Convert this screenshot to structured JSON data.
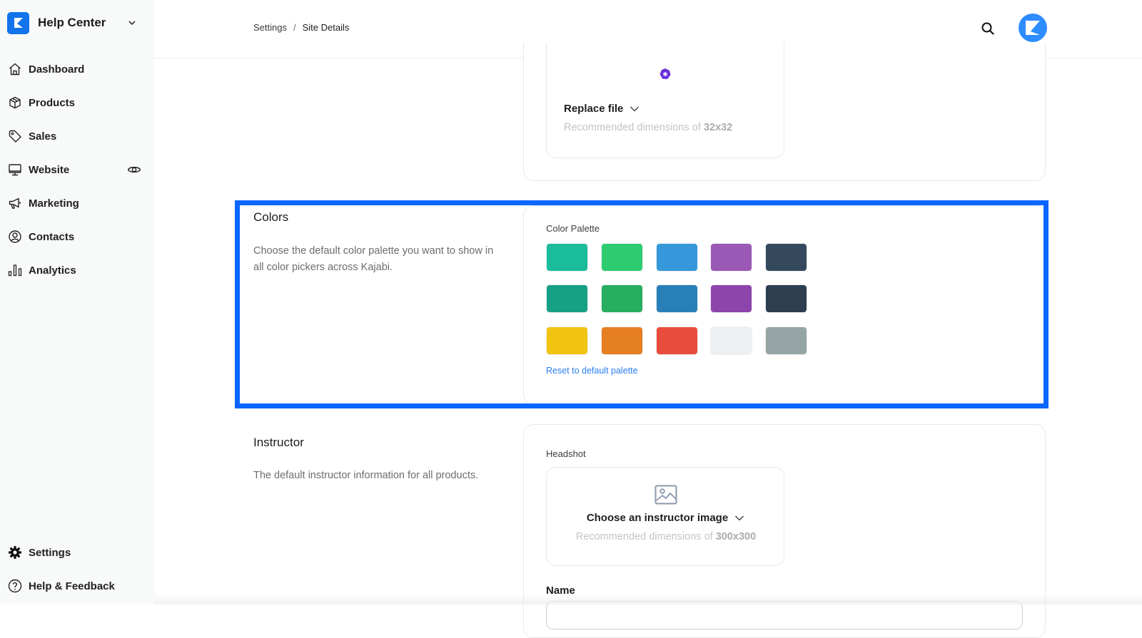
{
  "app": {
    "name": "Help Center"
  },
  "sidebar": {
    "items": [
      {
        "label": "Dashboard",
        "icon": "home-icon"
      },
      {
        "label": "Products",
        "icon": "box-icon"
      },
      {
        "label": "Sales",
        "icon": "tag-icon"
      },
      {
        "label": "Website",
        "icon": "monitor-icon",
        "trailing_icon": "eye-icon"
      },
      {
        "label": "Marketing",
        "icon": "megaphone-icon"
      },
      {
        "label": "Contacts",
        "icon": "user-circle-icon"
      },
      {
        "label": "Analytics",
        "icon": "bar-chart-icon"
      }
    ],
    "bottom_items": [
      {
        "label": "Settings",
        "icon": "gear-icon"
      },
      {
        "label": "Help & Feedback",
        "icon": "help-circle-icon"
      }
    ]
  },
  "header": {
    "breadcrumb": [
      "Settings",
      "Site Details"
    ],
    "breadcrumb_separator": "/"
  },
  "favicon_section": {
    "replace_label": "Replace file",
    "hint_prefix": "Recommended dimensions of",
    "hint_value": "32x32"
  },
  "colors_section": {
    "title": "Colors",
    "description": "Choose the default color palette you want to show in all color pickers across Kajabi.",
    "palette_label": "Color Palette",
    "palette": [
      [
        "#1abc9c",
        "#2ecc71",
        "#3498db",
        "#9b59b6",
        "#34495e"
      ],
      [
        "#16a085",
        "#27ae60",
        "#2980b9",
        "#8e44ad",
        "#2c3e50"
      ],
      [
        "#f1c40f",
        "#e67e22",
        "#e74c3c",
        "#ecf0f1",
        "#95a5a6"
      ]
    ],
    "reset_label": "Reset to default palette"
  },
  "instructor_section": {
    "title": "Instructor",
    "description": "The default instructor information for all products.",
    "headshot_label": "Headshot",
    "choose_label": "Choose an instructor image",
    "hint_prefix": "Recommended dimensions of",
    "hint_value": "300x300",
    "name_label": "Name",
    "name_value": ""
  },
  "colors": {
    "brand": "#1273eb",
    "highlight": "#0a66ff",
    "link": "#2a7ef0"
  }
}
